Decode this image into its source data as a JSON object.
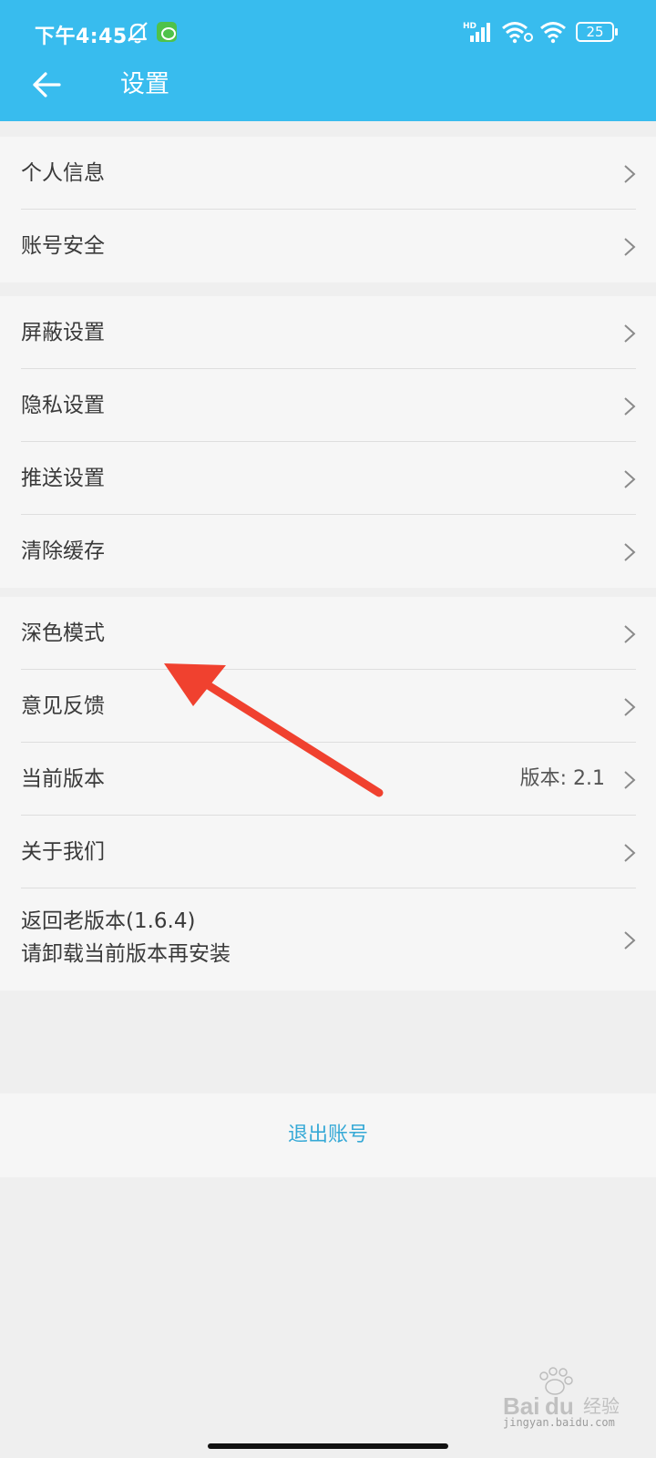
{
  "status_bar": {
    "time": "下午4:45",
    "battery": "25"
  },
  "header": {
    "title": "设置"
  },
  "groups": [
    {
      "items": [
        {
          "label": "个人信息"
        },
        {
          "label": "账号安全"
        }
      ]
    },
    {
      "items": [
        {
          "label": "屏蔽设置"
        },
        {
          "label": "隐私设置"
        },
        {
          "label": "推送设置"
        },
        {
          "label": "清除缓存"
        }
      ]
    },
    {
      "items": [
        {
          "label": "深色模式"
        },
        {
          "label": "意见反馈"
        },
        {
          "label": "当前版本",
          "value": "版本: 2.1"
        },
        {
          "label": "关于我们"
        },
        {
          "label": "返回老版本(1.6.4)",
          "label2": "请卸载当前版本再安装"
        }
      ]
    }
  ],
  "logout": {
    "label": "退出账号"
  },
  "watermark": {
    "brand": "Baidu 经验",
    "url": "jingyan.baidu.com"
  },
  "colors": {
    "header": "#38bcee",
    "annotation_arrow": "#f0412f",
    "logout_text": "#36a9d6"
  }
}
